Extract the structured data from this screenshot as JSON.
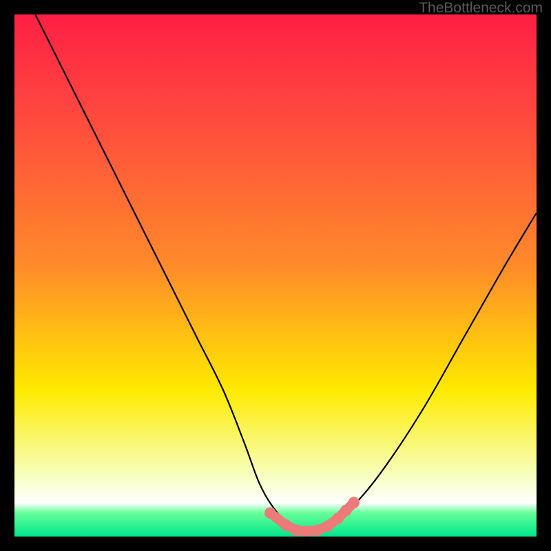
{
  "watermark": "TheBottleneck.com",
  "colors": {
    "top": "#ff1f44",
    "mid_red": "#ff4a3e",
    "orange": "#ff8a2a",
    "yellow": "#ffea00",
    "pale": "#f7ffba",
    "green_light": "#66ff99",
    "green": "#00e58a",
    "curve": "#000000",
    "marker": "#ec7a78",
    "frame": "#000000"
  },
  "chart_data": {
    "type": "line",
    "title": "",
    "xlabel": "",
    "ylabel": "",
    "xlim": [
      0,
      100
    ],
    "ylim": [
      0,
      100
    ],
    "series": [
      {
        "name": "bottleneck-curve",
        "x": [
          4,
          10,
          15,
          20,
          25,
          30,
          35,
          40,
          44,
          47,
          50,
          53,
          56,
          58,
          60,
          64,
          70,
          78,
          86,
          94,
          100
        ],
        "y": [
          100,
          88,
          78,
          68,
          58,
          48,
          38,
          28,
          18,
          10,
          5,
          2,
          1,
          1,
          2,
          5,
          12,
          24,
          38,
          52,
          62
        ]
      }
    ],
    "markers": {
      "name": "highlight-dots",
      "points": [
        {
          "x": 49,
          "y": 4.5
        },
        {
          "x": 52,
          "y": 2.2
        },
        {
          "x": 54,
          "y": 1.2
        },
        {
          "x": 56,
          "y": 1.0
        },
        {
          "x": 58,
          "y": 1.2
        },
        {
          "x": 60,
          "y": 2.0
        },
        {
          "x": 62,
          "y": 3.5
        },
        {
          "x": 63.5,
          "y": 5.0
        },
        {
          "x": 65,
          "y": 6.5
        }
      ],
      "radius": 1.1
    },
    "annotations": [],
    "grid": false,
    "legend": false
  }
}
